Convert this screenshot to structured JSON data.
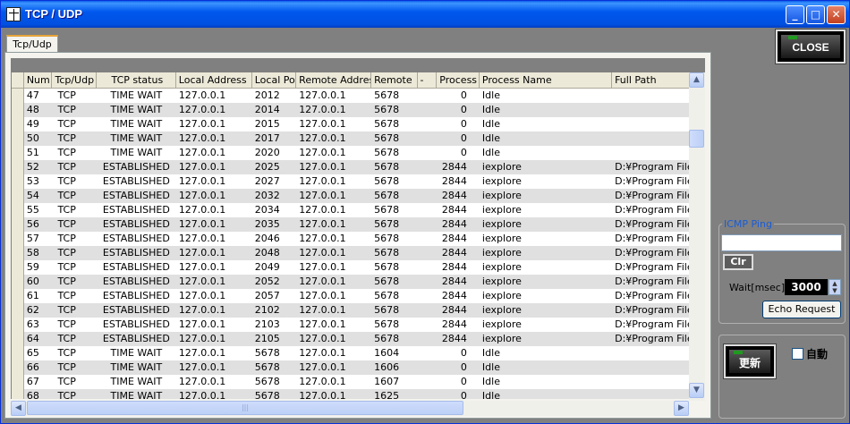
{
  "window": {
    "title": "TCP / UDP",
    "min_glyph": "_",
    "max_glyph": "□",
    "close_glyph": "✕"
  },
  "tab": {
    "label": "Tcp/Udp"
  },
  "table": {
    "columns": [
      "Num",
      "Tcp/Udp",
      "TCP status",
      "Local Address",
      "Local Po",
      "Remote Addres",
      "Remote",
      "-",
      "Process",
      "Process Name",
      "Full Path"
    ],
    "rows": [
      [
        "47",
        "TCP",
        "TIME WAIT",
        "127.0.0.1",
        "2012",
        "127.0.0.1",
        "5678",
        "",
        "0",
        "Idle",
        ""
      ],
      [
        "48",
        "TCP",
        "TIME WAIT",
        "127.0.0.1",
        "2014",
        "127.0.0.1",
        "5678",
        "",
        "0",
        "Idle",
        ""
      ],
      [
        "49",
        "TCP",
        "TIME WAIT",
        "127.0.0.1",
        "2015",
        "127.0.0.1",
        "5678",
        "",
        "0",
        "Idle",
        ""
      ],
      [
        "50",
        "TCP",
        "TIME WAIT",
        "127.0.0.1",
        "2017",
        "127.0.0.1",
        "5678",
        "",
        "0",
        "Idle",
        ""
      ],
      [
        "51",
        "TCP",
        "TIME WAIT",
        "127.0.0.1",
        "2020",
        "127.0.0.1",
        "5678",
        "",
        "0",
        "Idle",
        ""
      ],
      [
        "52",
        "TCP",
        "ESTABLISHED",
        "127.0.0.1",
        "2025",
        "127.0.0.1",
        "5678",
        "",
        "2844",
        "iexplore",
        "D:¥Program Files"
      ],
      [
        "53",
        "TCP",
        "ESTABLISHED",
        "127.0.0.1",
        "2027",
        "127.0.0.1",
        "5678",
        "",
        "2844",
        "iexplore",
        "D:¥Program Files"
      ],
      [
        "54",
        "TCP",
        "ESTABLISHED",
        "127.0.0.1",
        "2032",
        "127.0.0.1",
        "5678",
        "",
        "2844",
        "iexplore",
        "D:¥Program Files"
      ],
      [
        "55",
        "TCP",
        "ESTABLISHED",
        "127.0.0.1",
        "2034",
        "127.0.0.1",
        "5678",
        "",
        "2844",
        "iexplore",
        "D:¥Program Files"
      ],
      [
        "56",
        "TCP",
        "ESTABLISHED",
        "127.0.0.1",
        "2035",
        "127.0.0.1",
        "5678",
        "",
        "2844",
        "iexplore",
        "D:¥Program Files"
      ],
      [
        "57",
        "TCP",
        "ESTABLISHED",
        "127.0.0.1",
        "2046",
        "127.0.0.1",
        "5678",
        "",
        "2844",
        "iexplore",
        "D:¥Program Files"
      ],
      [
        "58",
        "TCP",
        "ESTABLISHED",
        "127.0.0.1",
        "2048",
        "127.0.0.1",
        "5678",
        "",
        "2844",
        "iexplore",
        "D:¥Program Files"
      ],
      [
        "59",
        "TCP",
        "ESTABLISHED",
        "127.0.0.1",
        "2049",
        "127.0.0.1",
        "5678",
        "",
        "2844",
        "iexplore",
        "D:¥Program Files"
      ],
      [
        "60",
        "TCP",
        "ESTABLISHED",
        "127.0.0.1",
        "2052",
        "127.0.0.1",
        "5678",
        "",
        "2844",
        "iexplore",
        "D:¥Program Files"
      ],
      [
        "61",
        "TCP",
        "ESTABLISHED",
        "127.0.0.1",
        "2057",
        "127.0.0.1",
        "5678",
        "",
        "2844",
        "iexplore",
        "D:¥Program Files"
      ],
      [
        "62",
        "TCP",
        "ESTABLISHED",
        "127.0.0.1",
        "2102",
        "127.0.0.1",
        "5678",
        "",
        "2844",
        "iexplore",
        "D:¥Program Files"
      ],
      [
        "63",
        "TCP",
        "ESTABLISHED",
        "127.0.0.1",
        "2103",
        "127.0.0.1",
        "5678",
        "",
        "2844",
        "iexplore",
        "D:¥Program Files"
      ],
      [
        "64",
        "TCP",
        "ESTABLISHED",
        "127.0.0.1",
        "2105",
        "127.0.0.1",
        "5678",
        "",
        "2844",
        "iexplore",
        "D:¥Program Files"
      ],
      [
        "65",
        "TCP",
        "TIME WAIT",
        "127.0.0.1",
        "5678",
        "127.0.0.1",
        "1604",
        "",
        "0",
        "Idle",
        ""
      ],
      [
        "66",
        "TCP",
        "TIME WAIT",
        "127.0.0.1",
        "5678",
        "127.0.0.1",
        "1606",
        "",
        "0",
        "Idle",
        ""
      ],
      [
        "67",
        "TCP",
        "TIME WAIT",
        "127.0.0.1",
        "5678",
        "127.0.0.1",
        "1607",
        "",
        "0",
        "Idle",
        ""
      ],
      [
        "68",
        "TCP",
        "TIME WAIT",
        "127.0.0.1",
        "5678",
        "127.0.0.1",
        "1625",
        "",
        "0",
        "Idle",
        ""
      ]
    ]
  },
  "close_button": {
    "label": "CLOSE"
  },
  "ping": {
    "title": "ICMP Ping",
    "input_value": "",
    "clear_label": "Clr",
    "wait_label": "Wait[msec]",
    "wait_value": "3000",
    "echo_label": "Echo Request"
  },
  "update": {
    "button_label": "更新",
    "auto_label": "自動",
    "auto_checked": false
  },
  "colors": {
    "titlebar": "#0058ee",
    "background": "#808080",
    "accent_led": "#1f9a1f",
    "group_title": "#1a5cd6"
  }
}
